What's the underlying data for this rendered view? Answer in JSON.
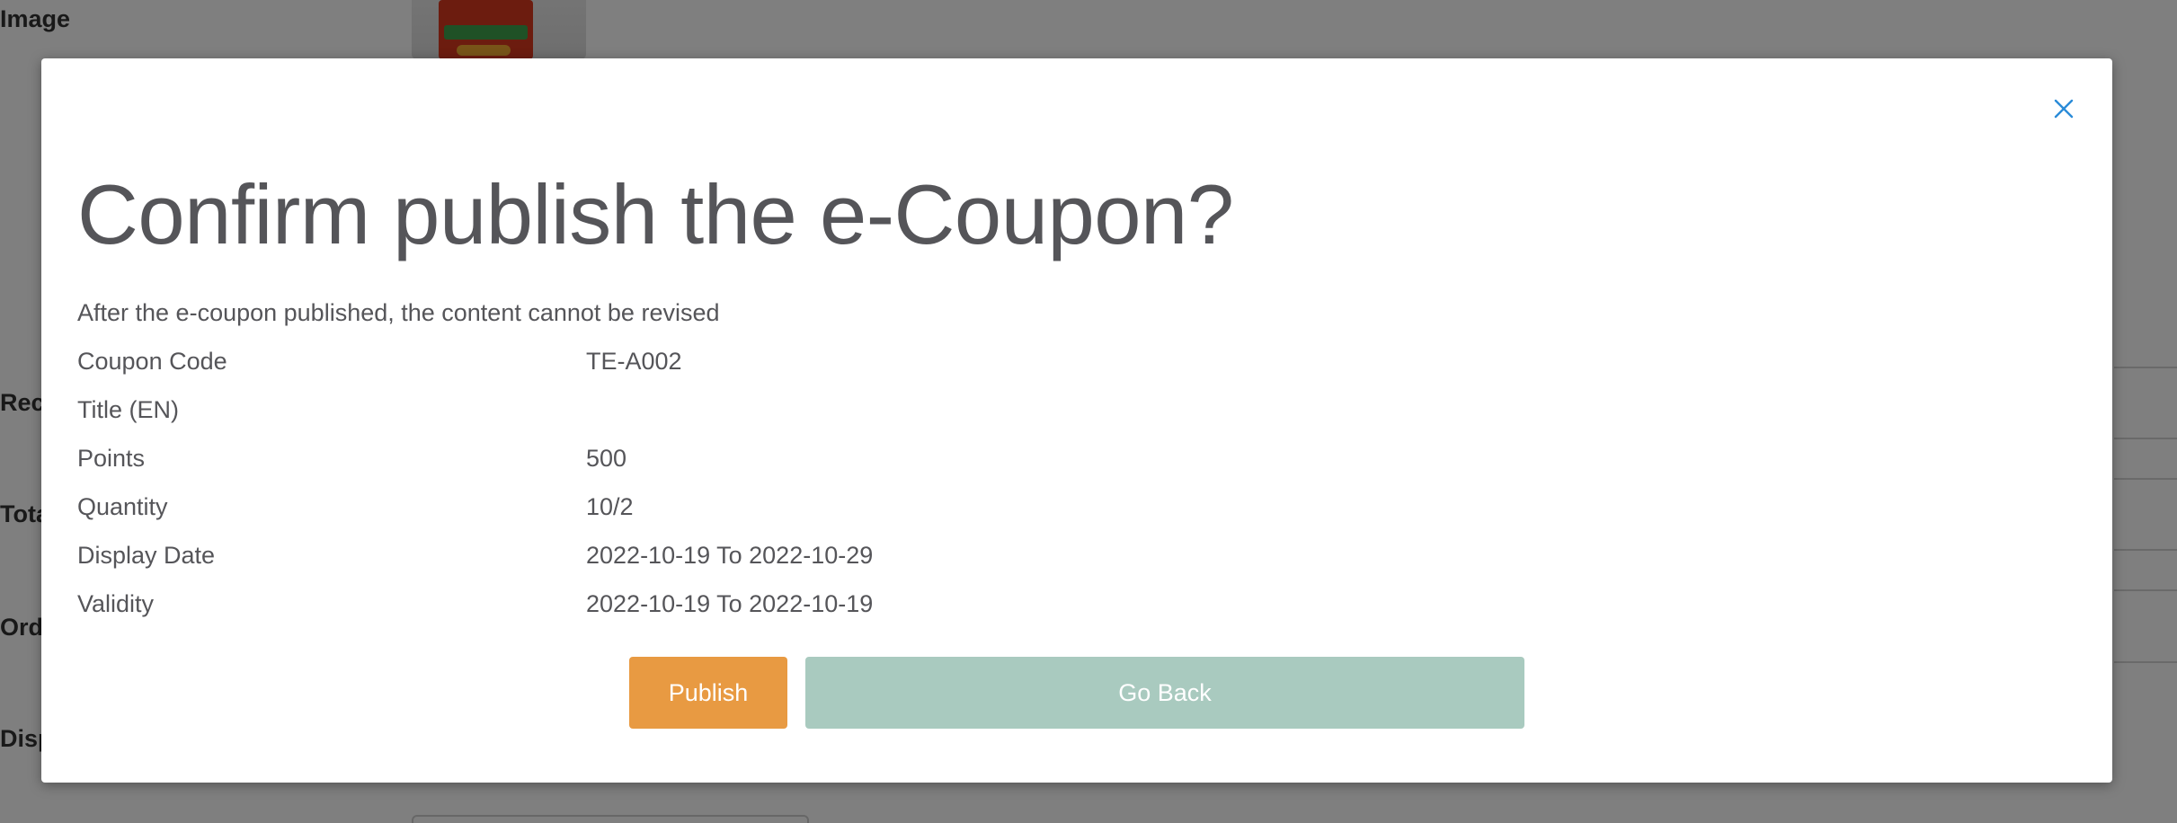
{
  "background": {
    "labels": {
      "image": "Image",
      "rec": "Rec",
      "total": "Tota",
      "order": "Ord",
      "display": "Disp"
    }
  },
  "modal": {
    "title": "Confirm publish the e-Coupon?",
    "subtitle": "After the e-coupon published, the content cannot be revised",
    "close_icon": "close-icon",
    "details": [
      {
        "label": "Coupon Code",
        "value": "TE-A002"
      },
      {
        "label": "Title (EN)",
        "value": ""
      },
      {
        "label": "Points",
        "value": "500"
      },
      {
        "label": "Quantity",
        "value": "10/2"
      },
      {
        "label": "Display Date",
        "value": "2022-10-19 To 2022-10-29"
      },
      {
        "label": "Validity",
        "value": "2022-10-19 To 2022-10-19"
      }
    ],
    "buttons": {
      "publish": "Publish",
      "go_back": "Go Back"
    }
  },
  "colors": {
    "publish": "#e89a42",
    "go_back": "#a9cabf",
    "close_icon": "#2a8bd8",
    "text": "#555559"
  }
}
